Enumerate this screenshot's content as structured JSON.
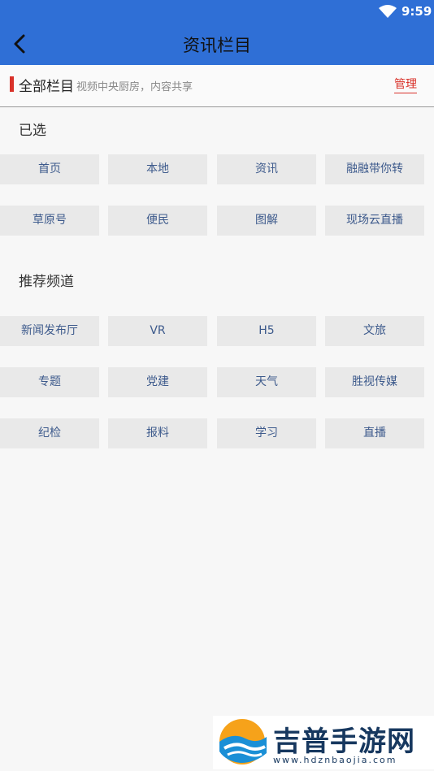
{
  "status": {
    "time": "9:59"
  },
  "app_bar": {
    "title": "资讯栏目"
  },
  "header": {
    "all_label": "全部栏目",
    "subtitle": "视频中央厨房，内容共享",
    "manage_label": "管理"
  },
  "selected": {
    "title": "已选",
    "items": [
      "首页",
      "本地",
      "资讯",
      "融融带你转",
      "草原号",
      "便民",
      "图解",
      "现场云直播"
    ]
  },
  "recommended": {
    "title": "推荐频道",
    "items": [
      "新闻发布厅",
      "VR",
      "H5",
      "文旅",
      "专题",
      "党建",
      "天气",
      "胜视传媒",
      "纪检",
      "报料",
      "学习",
      "直播"
    ]
  },
  "watermark": {
    "text": "吉普手游网",
    "url": "www.hdznbaojia.com"
  },
  "colors": {
    "primary": "#2f6fd6",
    "accent": "#d9322a",
    "chip_bg": "#e9e9e9",
    "chip_text": "#3d5a8c"
  }
}
